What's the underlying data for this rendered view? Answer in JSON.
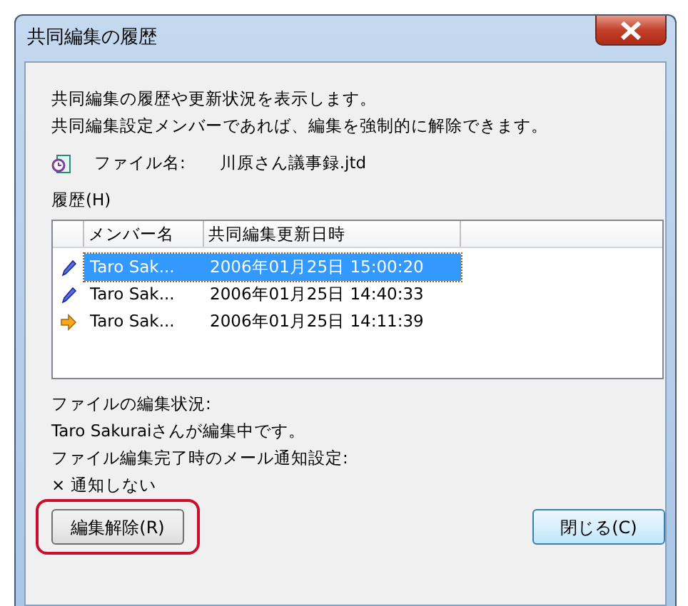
{
  "window": {
    "title": "共同編集の履歴"
  },
  "description": [
    "共同編集の履歴や更新状況を表示します。",
    "共同編集設定メンバーであれば、編集を強制的に解除できます。"
  ],
  "file": {
    "label": "ファイル名:",
    "name": "川原さん議事録.jtd"
  },
  "history": {
    "label": "履歴(H)",
    "columns": [
      "メンバー名",
      "共同編集更新日時"
    ],
    "rows": [
      {
        "kind": "pencil",
        "member": "Taro Sak...",
        "datetime": "2006年01月25日 15:00:20",
        "selected": true
      },
      {
        "kind": "pencil",
        "member": "Taro Sak...",
        "datetime": "2006年01月25日 14:40:33",
        "selected": false
      },
      {
        "kind": "arrow",
        "member": "Taro Sak...",
        "datetime": "2006年01月25日 14:11:39",
        "selected": false
      }
    ]
  },
  "status": [
    {
      "label": "ファイルの編集状況:",
      "value": "Taro Sakuraiさんが編集中です。"
    },
    {
      "label": "ファイル編集完了時のメール通知設定:",
      "value": "× 通知しない"
    }
  ],
  "buttons": [
    {
      "label": "編集解除(R)",
      "highlighted": true,
      "default": false
    },
    {
      "label": "閉じる(C)",
      "highlighted": false,
      "default": true
    }
  ]
}
